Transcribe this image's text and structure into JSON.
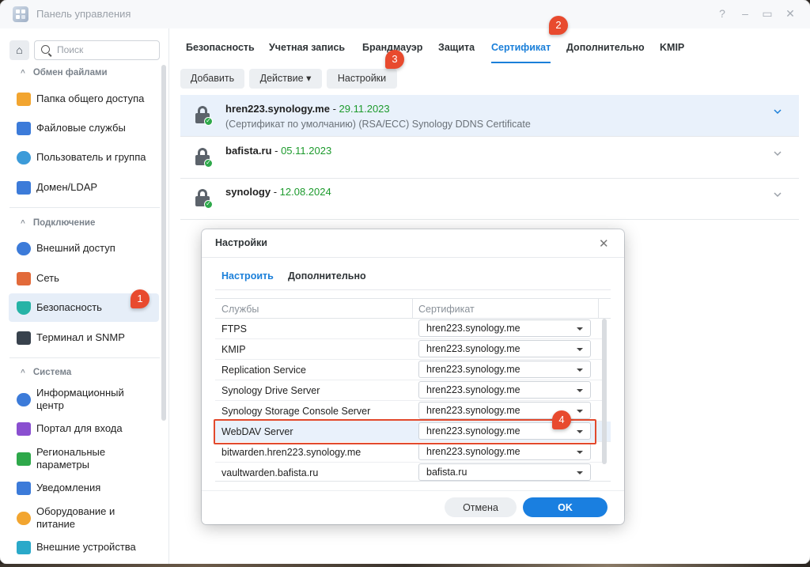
{
  "window": {
    "title": "Панель управления",
    "help": "?",
    "minimize": "–",
    "maximize": "▭",
    "close": "✕"
  },
  "sidebar": {
    "home_icon": "⌂",
    "search_placeholder": "Поиск",
    "sections": [
      {
        "title": "Обмен файлами",
        "chevron": "^"
      },
      {
        "title": "Подключение",
        "chevron": "^"
      },
      {
        "title": "Система",
        "chevron": "^"
      }
    ],
    "items": [
      {
        "label": "Папка общего доступа",
        "icon": "folder-icon",
        "color": "#f2a530"
      },
      {
        "label": "Файловые службы",
        "icon": "file-services-icon",
        "color": "#3c7bd9"
      },
      {
        "label": "Пользователь и группа",
        "icon": "users-icon",
        "color": "#3c9bd9"
      },
      {
        "label": "Домен/LDAP",
        "icon": "domain-icon",
        "color": "#3c7bd9"
      },
      {
        "label": "Внешний доступ",
        "icon": "external-access-icon",
        "color": "#3c7bd9"
      },
      {
        "label": "Сеть",
        "icon": "network-icon",
        "color": "#e26a3a"
      },
      {
        "label": "Безопасность",
        "icon": "shield-icon",
        "color": "#26b3a6"
      },
      {
        "label": "Терминал и SNMP",
        "icon": "terminal-icon",
        "color": "#38424d"
      },
      {
        "label": "Информационный центр",
        "icon": "info-icon",
        "color": "#3c7bd9"
      },
      {
        "label": "Портал для входа",
        "icon": "portal-icon",
        "color": "#8a4fd0"
      },
      {
        "label": "Региональные параметры",
        "icon": "regional-icon",
        "color": "#2ea84a"
      },
      {
        "label": "Уведомления",
        "icon": "notifications-icon",
        "color": "#3c7bd9"
      },
      {
        "label": "Оборудование и питание",
        "icon": "hardware-power-icon",
        "color": "#f2a530"
      },
      {
        "label": "Внешние устройства",
        "icon": "external-devices-icon",
        "color": "#2aa9c9"
      }
    ]
  },
  "tabs": [
    "Безопасность",
    "Учетная запись",
    "Брандмауэр",
    "Защита",
    "Сертификат",
    "Дополнительно",
    "KMIP"
  ],
  "toolbar": {
    "add": "Добавить",
    "action": "Действие ▾",
    "settings": "Настройки"
  },
  "certificates": [
    {
      "name": "hren223.synology.me",
      "sep": " - ",
      "date": "29.11.2023",
      "desc": "(Сертификат по умолчанию) (RSA/ECC) Synology DDNS Certificate"
    },
    {
      "name": "bafista.ru",
      "sep": " - ",
      "date": "05.11.2023",
      "desc": ""
    },
    {
      "name": "synology",
      "sep": " - ",
      "date": "12.08.2024",
      "desc": ""
    }
  ],
  "badges": [
    "1",
    "2",
    "3",
    "4"
  ],
  "dialog": {
    "title": "Настройки",
    "close": "✕",
    "tabs": [
      "Настроить",
      "Дополнительно"
    ],
    "columns": [
      "Службы",
      "Сертификат"
    ],
    "rows": [
      {
        "service": "FTPS",
        "cert": "hren223.synology.me"
      },
      {
        "service": "KMIP",
        "cert": "hren223.synology.me"
      },
      {
        "service": "Replication Service",
        "cert": "hren223.synology.me"
      },
      {
        "service": "Synology Drive Server",
        "cert": "hren223.synology.me"
      },
      {
        "service": "Synology Storage Console Server",
        "cert": "hren223.synology.me"
      },
      {
        "service": "WebDAV Server",
        "cert": "hren223.synology.me"
      },
      {
        "service": "bitwarden.hren223.synology.me",
        "cert": "hren223.synology.me"
      },
      {
        "service": "vaultwarden.bafista.ru",
        "cert": "bafista.ru"
      }
    ],
    "cancel": "Отмена",
    "ok": "OK"
  }
}
